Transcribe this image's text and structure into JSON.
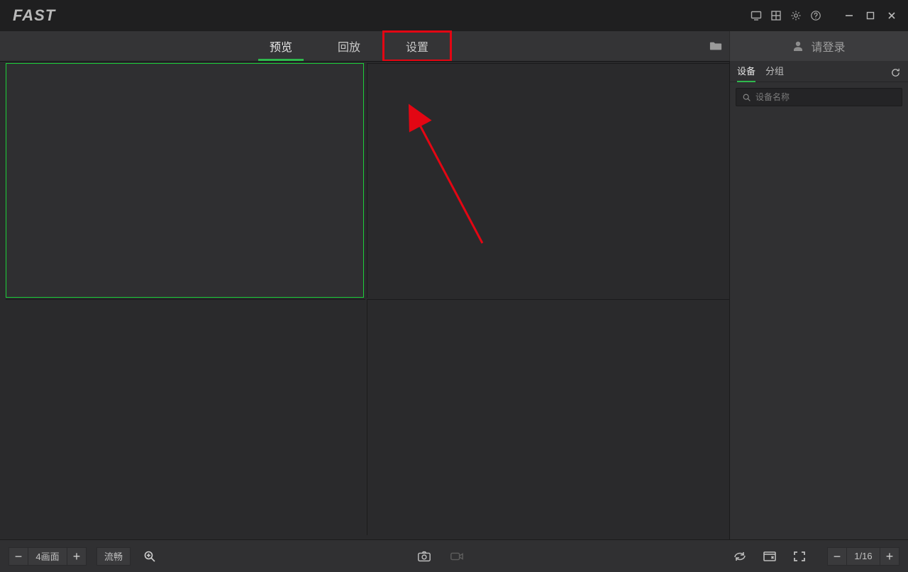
{
  "app": {
    "name": "FAST"
  },
  "tabs": {
    "preview": "预览",
    "playback": "回放",
    "settings": "设置",
    "active": "preview"
  },
  "login": {
    "label": "请登录"
  },
  "right_panel": {
    "tabs": {
      "device": "设备",
      "group": "分组",
      "active": "device"
    },
    "search_placeholder": "设备名称"
  },
  "footer": {
    "layout_label": "4画面",
    "stream_label": "流畅",
    "page_label": "1/16"
  }
}
